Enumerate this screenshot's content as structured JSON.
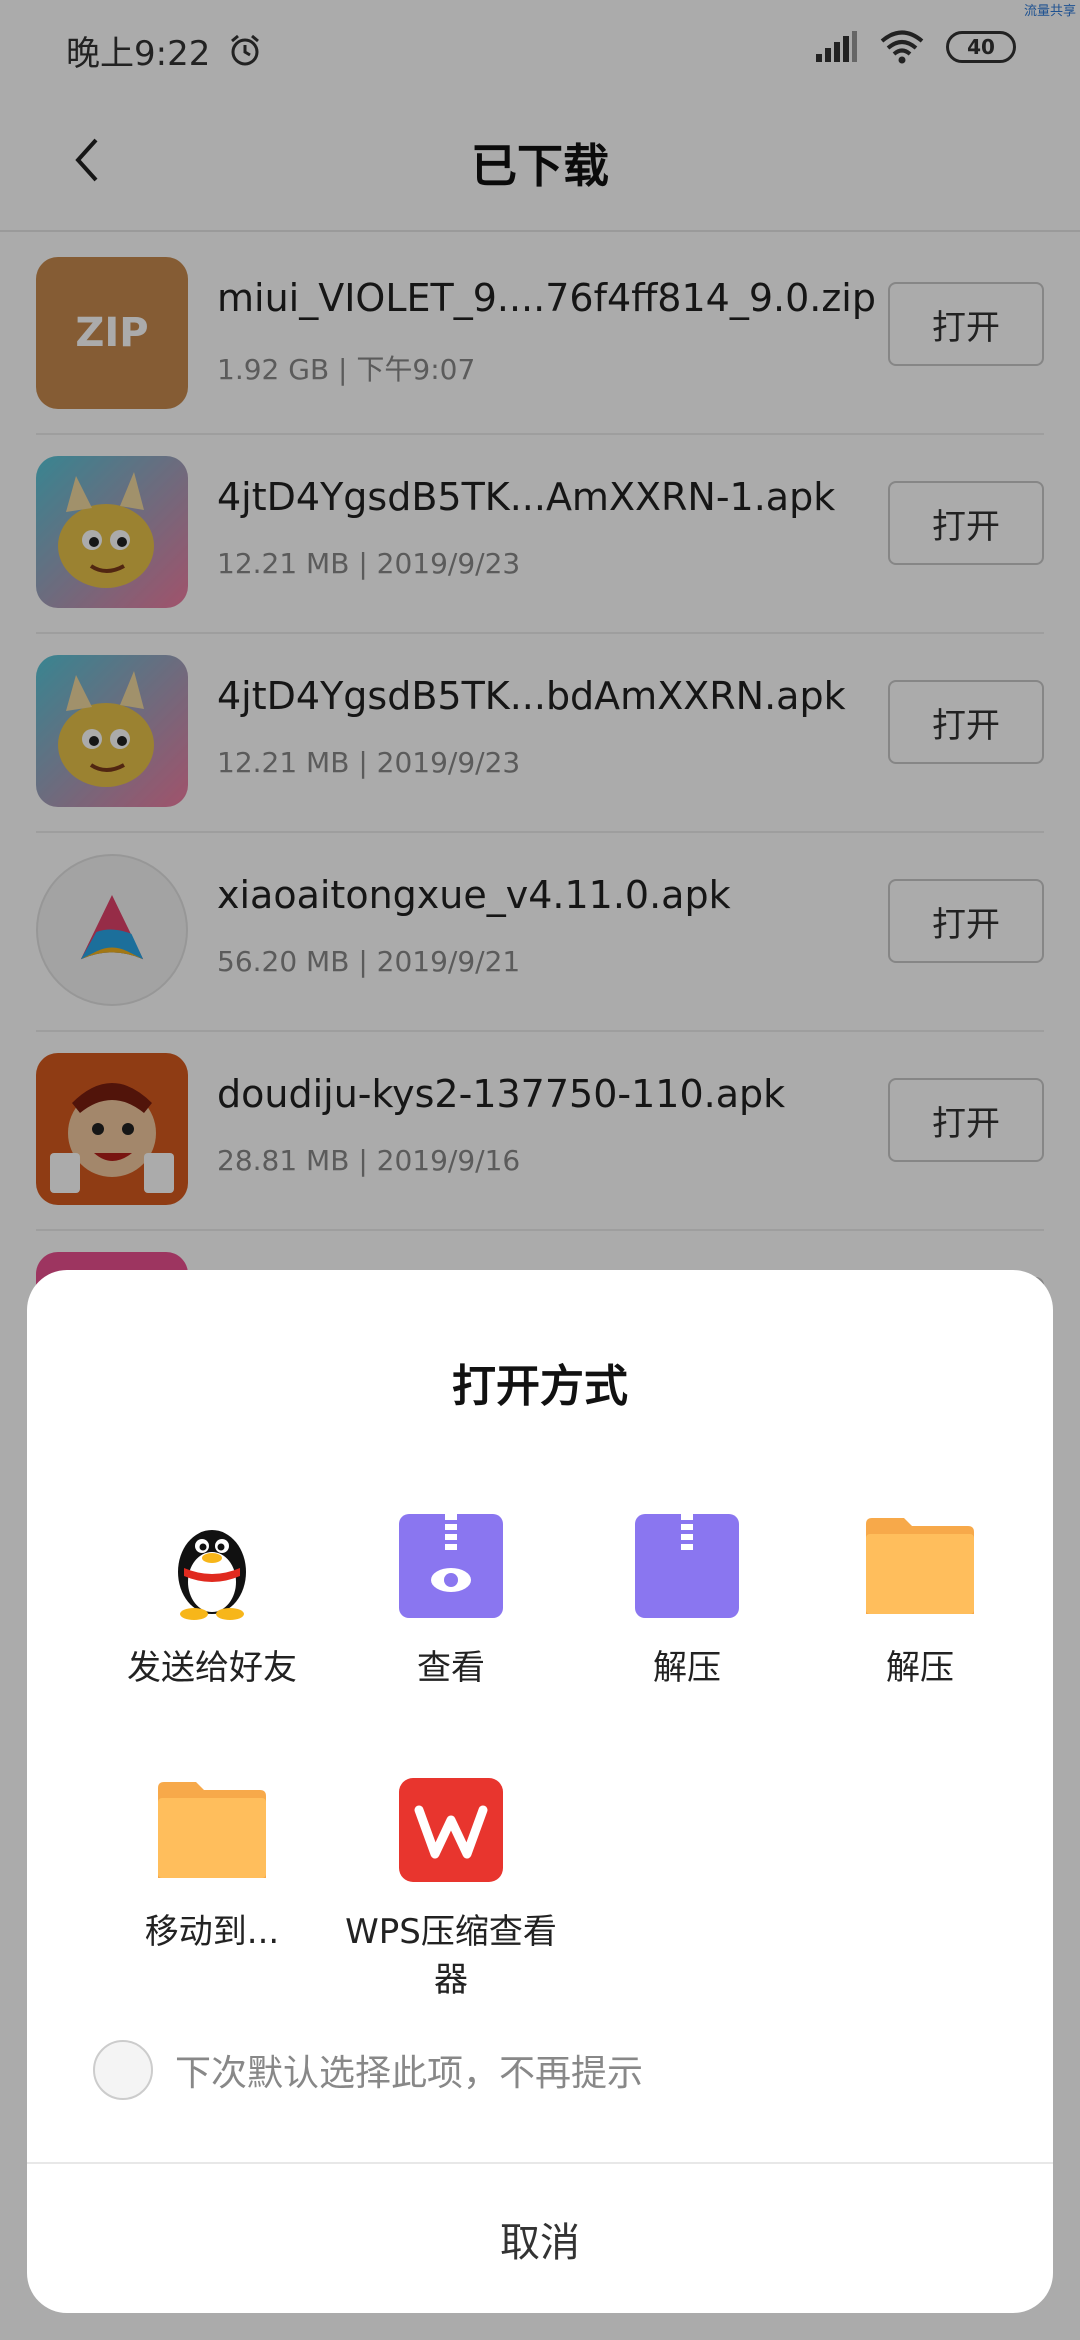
{
  "status_bar": {
    "time": "晚上9:22",
    "battery": "40",
    "corner_tag": "流量共享"
  },
  "header": {
    "title": "已下载"
  },
  "files": [
    {
      "name": "miui_VIOLET_9....76f4ff814_9.0.zip",
      "meta": "1.92 GB | 下午9:07",
      "icon": "zip-icon",
      "icon_text": "ZIP",
      "action": "打开"
    },
    {
      "name": "4jtD4YgsdB5TK...AmXXRN-1.apk",
      "meta": "12.21 MB | 2019/9/23",
      "icon": "dragon-app-icon",
      "action": "打开"
    },
    {
      "name": "4jtD4YgsdB5TK...bdAmXXRN.apk",
      "meta": "12.21 MB | 2019/9/23",
      "icon": "dragon-app-icon",
      "action": "打开"
    },
    {
      "name": "xiaoaitongxue_v4.11.0.apk",
      "meta": "56.20 MB | 2019/9/21",
      "icon": "xiaoai-app-icon",
      "action": "打开"
    },
    {
      "name": "doudiju-kys2-137750-110.apk",
      "meta": "28.81 MB | 2019/9/16",
      "icon": "card-game-app-icon",
      "action": "打开"
    }
  ],
  "dialog": {
    "title": "打开方式",
    "apps": [
      {
        "label": "发送给好友",
        "icon": "qq-penguin-icon"
      },
      {
        "label": "查看",
        "icon": "zip-viewer-icon"
      },
      {
        "label": "解压",
        "icon": "zip-extract-icon"
      },
      {
        "label": "解压",
        "icon": "folder-icon"
      },
      {
        "label": "移动到...",
        "icon": "folder-icon"
      },
      {
        "label": "WPS压缩查看器",
        "icon": "wps-icon"
      }
    ],
    "checkbox_label": "下次默认选择此项，不再提示",
    "cancel": "取消"
  },
  "colors": {
    "zip_brown": "#c68a4e",
    "zip_purple": "#8a76f0",
    "folder_yellow": "#ffbe5c",
    "wps_red": "#e8352e"
  }
}
